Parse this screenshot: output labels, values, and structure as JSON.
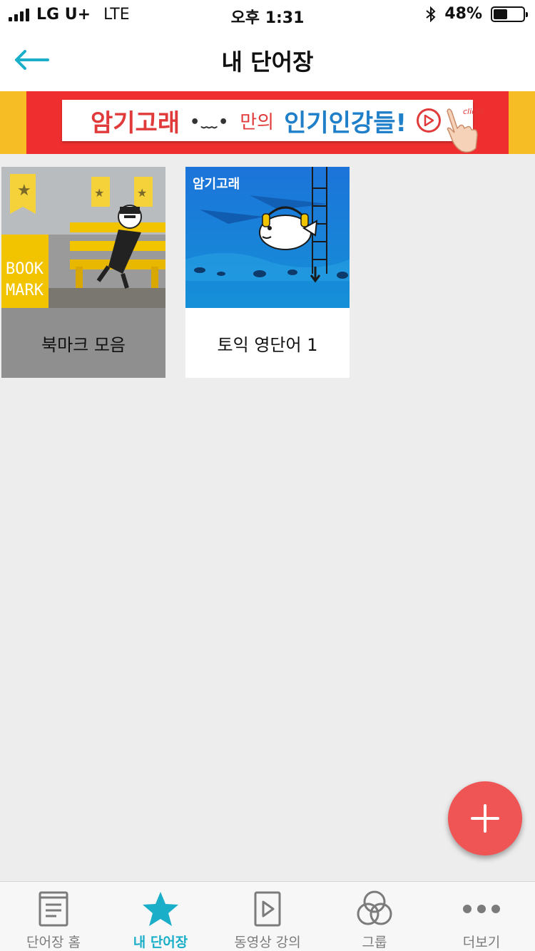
{
  "status_bar": {
    "carrier": "LG U+",
    "network": "LTE",
    "time": "오후 1:31",
    "battery_text": "48%",
    "battery_level": 0.48
  },
  "nav": {
    "title": "내 단어장",
    "back_icon": "back-arrow-icon"
  },
  "banner": {
    "brand": "암기고래",
    "connector": "만의",
    "headline": "인기인강들!",
    "cta_icon": "play-circle-icon",
    "click_text": "click!"
  },
  "cards": [
    {
      "title": "북마크 모음",
      "image_text": [
        "BOOK",
        "MARK"
      ]
    },
    {
      "title": "토익 영단어 1",
      "image_text": "암기고래"
    }
  ],
  "fab": {
    "icon": "plus-icon"
  },
  "tabs": [
    {
      "label": "단어장 홈",
      "icon": "book-icon",
      "active": false
    },
    {
      "label": "내 단어장",
      "icon": "star-icon",
      "active": true
    },
    {
      "label": "동영상 강의",
      "icon": "video-play-icon",
      "active": false
    },
    {
      "label": "그룹",
      "icon": "group-circles-icon",
      "active": false
    },
    {
      "label": "더보기",
      "icon": "more-dots-icon",
      "active": false
    }
  ],
  "colors": {
    "accent": "#1aaec8",
    "fab": "#f05556",
    "banner_red": "#ef2f2f",
    "banner_yellow": "#f6bd25"
  }
}
